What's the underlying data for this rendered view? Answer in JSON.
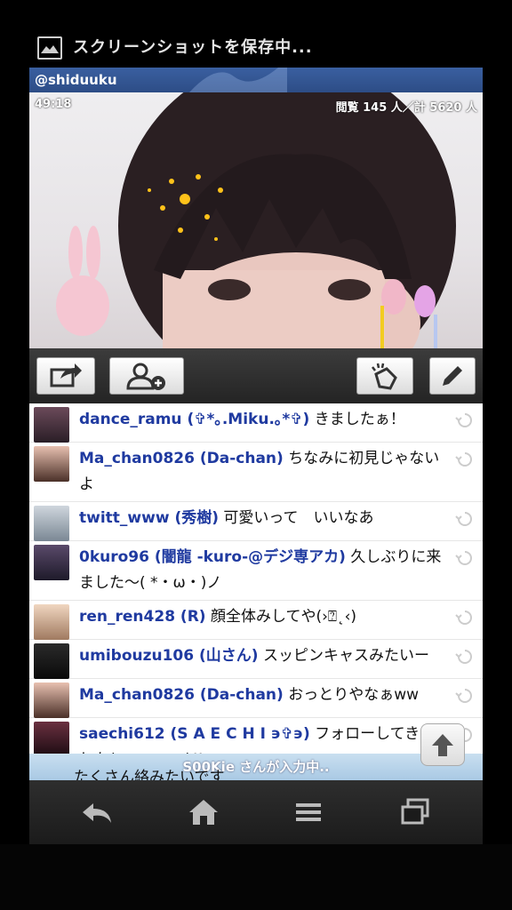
{
  "status_bar": {
    "notification_text": "スクリーンショットを保存中..."
  },
  "broadcast": {
    "username": "@shiduuku",
    "elapsed": "49:18",
    "views_text": "閲覧 145 人／計 5620 人"
  },
  "toolbar": {
    "share_icon": "share-icon",
    "add_user_icon": "add-user-icon",
    "clap_icon": "clap-icon",
    "edit_icon": "pencil-icon"
  },
  "comments": [
    {
      "user": "dance_ramu (✞*｡.Miku.｡*✞)",
      "text": "きましたぁ！"
    },
    {
      "user": "Ma_chan0826 (Da-chan)",
      "text": "ちなみに初見じゃないよ"
    },
    {
      "user": "twitt_www (秀樹)",
      "text": "可愛いって　いいなあ"
    },
    {
      "user": "0kuro96 (闇龍 -kuro-@デジ専アカ)",
      "text": "久しぶりに来ました〜( *・ω・)ノ"
    },
    {
      "user": "ren_ren428 (R)",
      "text": "顔全体みしてや(›⍰˛‹)"
    },
    {
      "user": "umibouzu106 (山さん)",
      "text": "スッピンキャスみたいー"
    },
    {
      "user": "Ma_chan0826 (Da-chan)",
      "text": "おっとりやなぁww"
    },
    {
      "user": "saechi612 (S A E C H I ϶✞϶)",
      "text": "フォローしてきました(⍰˛⍰·⍰⍰·⍰˛)♡"
    }
  ],
  "typing_banner": "S00Kie さんが入力中..",
  "overflow_line": "たくさん絡みたいです",
  "nav": {
    "back": "back-icon",
    "home": "home-icon",
    "menu": "menu-icon",
    "recent": "recent-apps-icon"
  }
}
